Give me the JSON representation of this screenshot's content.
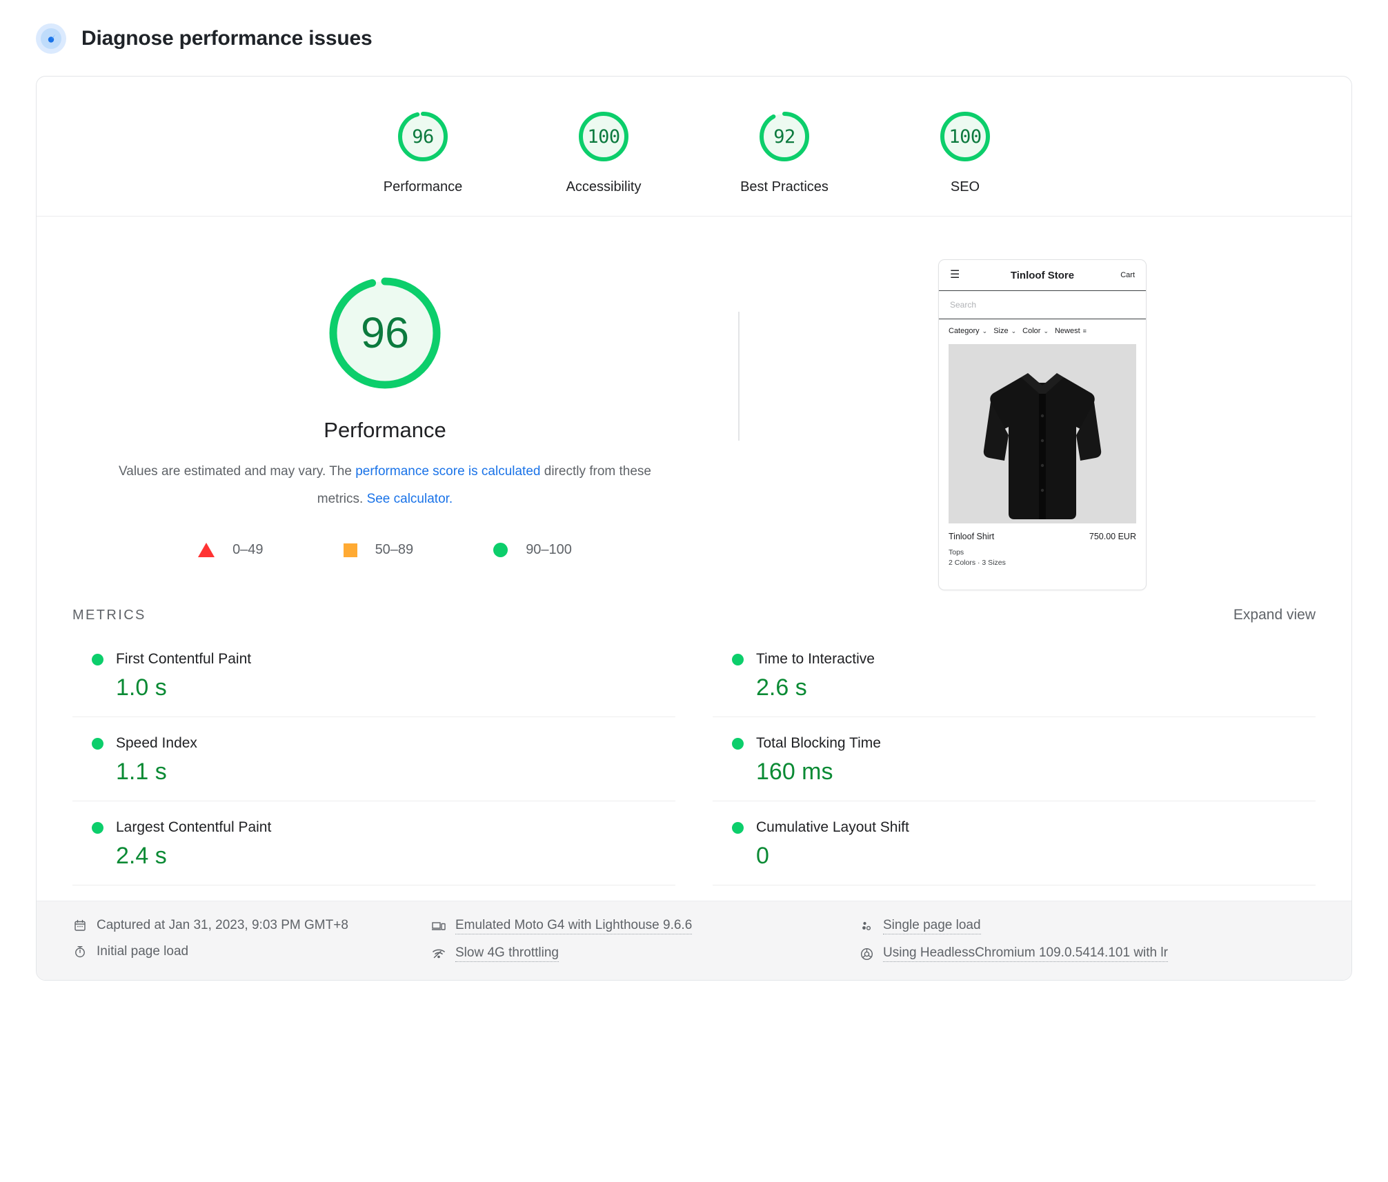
{
  "header": {
    "title": "Diagnose performance issues",
    "icon": "lighthouse-icon"
  },
  "category_scores": [
    {
      "score": "96",
      "label": "Performance",
      "percent": 96
    },
    {
      "score": "100",
      "label": "Accessibility",
      "percent": 100
    },
    {
      "score": "92",
      "label": "Best Practices",
      "percent": 92
    },
    {
      "score": "100",
      "label": "SEO",
      "percent": 100
    }
  ],
  "main_gauge": {
    "score": "96",
    "percent": 96,
    "label": "Performance"
  },
  "description": {
    "text_before": "Values are estimated and may vary. The ",
    "link1": "performance score is calculated",
    "text_mid": " directly from these metrics. ",
    "link2": "See calculator."
  },
  "legend": [
    {
      "shape": "triangle",
      "range": "0–49",
      "color": "#ff3333"
    },
    {
      "shape": "square",
      "range": "50–89",
      "color": "#ffaa33"
    },
    {
      "shape": "circle",
      "range": "90–100",
      "color": "#0cce6b"
    }
  ],
  "screenshot": {
    "hamburger": "☰",
    "store_name": "Tinloof Store",
    "cart": "Cart",
    "search_placeholder": "Search",
    "filters": [
      "Category",
      "Size",
      "Color",
      "Newest"
    ],
    "product_name": "Tinloof Shirt",
    "product_price": "750.00 EUR",
    "product_category": "Tops",
    "product_variants": "2 Colors · 3 Sizes"
  },
  "metrics_section": {
    "title": "METRICS",
    "expand_label": "Expand view",
    "items": [
      {
        "name": "First Contentful Paint",
        "value": "1.0 s",
        "status": "good"
      },
      {
        "name": "Time to Interactive",
        "value": "2.6 s",
        "status": "good"
      },
      {
        "name": "Speed Index",
        "value": "1.1 s",
        "status": "good"
      },
      {
        "name": "Total Blocking Time",
        "value": "160 ms",
        "status": "good"
      },
      {
        "name": "Largest Contentful Paint",
        "value": "2.4 s",
        "status": "good"
      },
      {
        "name": "Cumulative Layout Shift",
        "value": "0",
        "status": "good"
      }
    ]
  },
  "footer": {
    "captured_at": "Captured at Jan 31, 2023, 9:03 PM GMT+8",
    "initial_page_load": "Initial page load",
    "emulation": "Emulated Moto G4 with Lighthouse 9.6.6",
    "throttling": "Slow 4G throttling",
    "page_load_type": "Single page load",
    "user_agent": "Using HeadlessChromium 109.0.5414.101 with lr"
  },
  "colors": {
    "green": "#0cce6b",
    "green_dark": "#0a8a34",
    "green_fill": "#edfaf1",
    "orange": "#ffaa33",
    "red": "#ff3333",
    "link_blue": "#1a73e8"
  }
}
